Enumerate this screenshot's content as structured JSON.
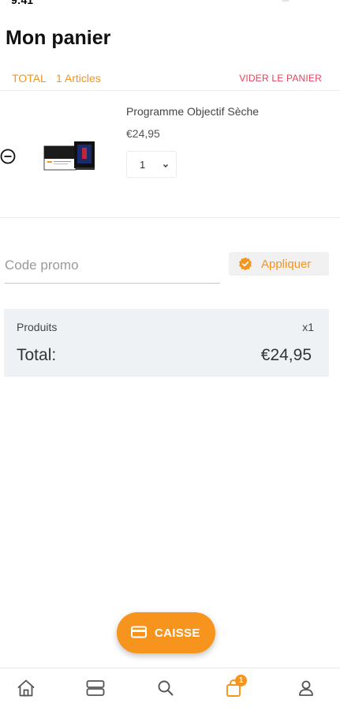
{
  "status_bar": {
    "time": "9:41"
  },
  "header": {
    "title": "Mon panier"
  },
  "summary": {
    "total_label": "TOTAL",
    "count_label": "1 Articles",
    "clear_label": "VIDER LE PANIER"
  },
  "cart": {
    "items": [
      {
        "name": "Programme Objectif Sèche",
        "price": "€24,95",
        "quantity": "1"
      }
    ]
  },
  "promo": {
    "placeholder": "Code promo",
    "value": "",
    "apply_label": "Appliquer"
  },
  "totals": {
    "products_label": "Produits",
    "products_count": "x1",
    "total_label": "Total:",
    "total_value": "€24,95"
  },
  "checkout": {
    "label": "CAISSE"
  },
  "nav": {
    "items": [
      {
        "icon": "home-icon"
      },
      {
        "icon": "categories-icon"
      },
      {
        "icon": "search-icon"
      },
      {
        "icon": "cart-icon",
        "badge": "1"
      },
      {
        "icon": "account-icon"
      }
    ],
    "active": "cart-icon"
  },
  "colors": {
    "accent": "#f7941d",
    "danger": "#e8425b",
    "totals_background": "#eff2f4",
    "nav_icon": "#555555"
  }
}
